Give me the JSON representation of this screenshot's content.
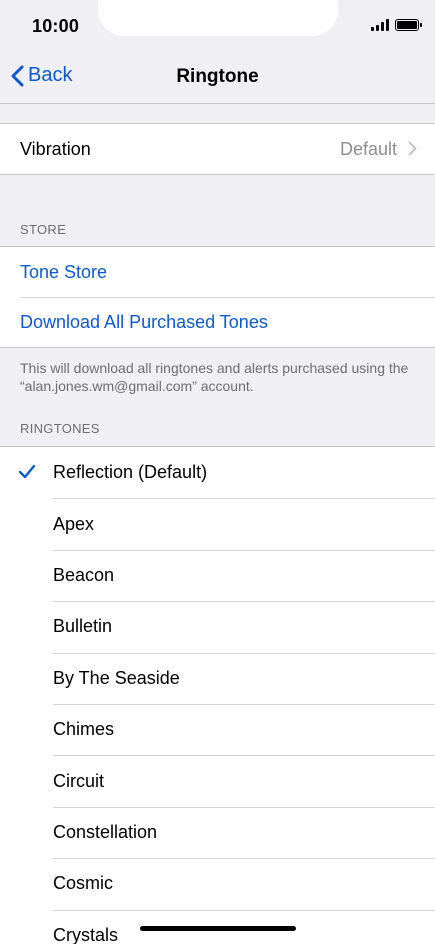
{
  "status_bar": {
    "time": "10:00"
  },
  "nav": {
    "back_label": "Back",
    "title": "Ringtone"
  },
  "vibration": {
    "label": "Vibration",
    "value": "Default"
  },
  "store": {
    "header": "STORE",
    "items": [
      "Tone Store",
      "Download All Purchased Tones"
    ],
    "footer": "This will download all ringtones and alerts purchased using the “alan.jones.wm@gmail.com” account."
  },
  "ringtones": {
    "header": "RINGTONES",
    "selected": "Reflection (Default)",
    "items": [
      "Reflection (Default)",
      "Apex",
      "Beacon",
      "Bulletin",
      "By The Seaside",
      "Chimes",
      "Circuit",
      "Constellation",
      "Cosmic",
      "Crystals"
    ]
  },
  "colors": {
    "accent": "#0a5ad6",
    "background": "#efeff4",
    "secondary_text": "#8e8e93"
  }
}
